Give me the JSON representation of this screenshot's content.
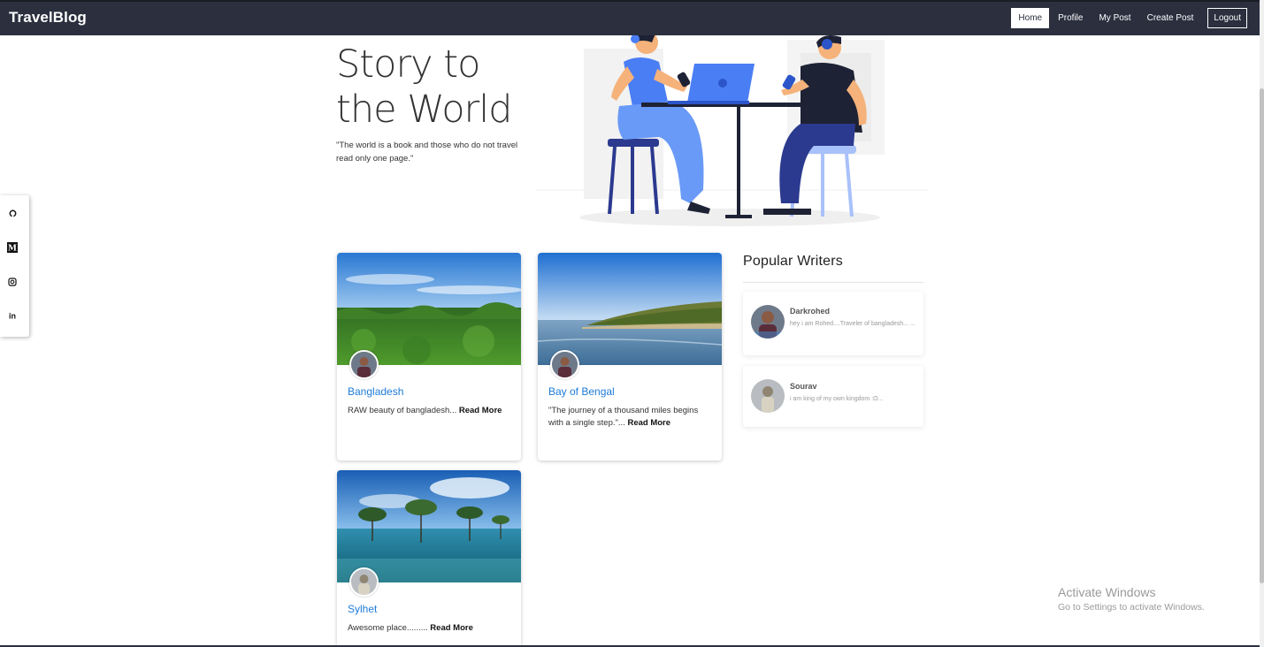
{
  "nav": {
    "brand": "TravelBlog",
    "links": [
      "Home",
      "Profile",
      "My Post",
      "Create Post"
    ],
    "logout": "Logout"
  },
  "hero": {
    "title_line1": "Story to",
    "title_line2": "the World",
    "quote": "\"The world is a book and those who do not travel read only one page.\""
  },
  "social": [
    "github-icon",
    "medium-icon",
    "instagram-icon",
    "linkedin-icon"
  ],
  "posts": [
    {
      "title": "Bangladesh",
      "excerpt": "RAW beauty of bangladesh...",
      "read_more": "Read More"
    },
    {
      "title": "Bay of Bengal",
      "excerpt": "\"The journey of a thousand miles begins with a single step.\"...",
      "read_more": "Read More"
    },
    {
      "title": "Sylhet",
      "excerpt": "Awesome place.........",
      "read_more": "Read More"
    }
  ],
  "popular_writers": {
    "title": "Popular Writers",
    "writers": [
      {
        "name": "Darkrohed",
        "bio": "hey i am Rohed....Traveler of bangladesh... ..."
      },
      {
        "name": "Sourav",
        "bio": "i am king of my own kingdom :O..."
      }
    ]
  },
  "watermark": {
    "title": "Activate Windows",
    "subtitle": "Go to Settings to activate Windows."
  },
  "colors": {
    "navbar": "#2b2f3e",
    "link": "#1e7bd8",
    "accent_blue": "#4a7ef5"
  }
}
